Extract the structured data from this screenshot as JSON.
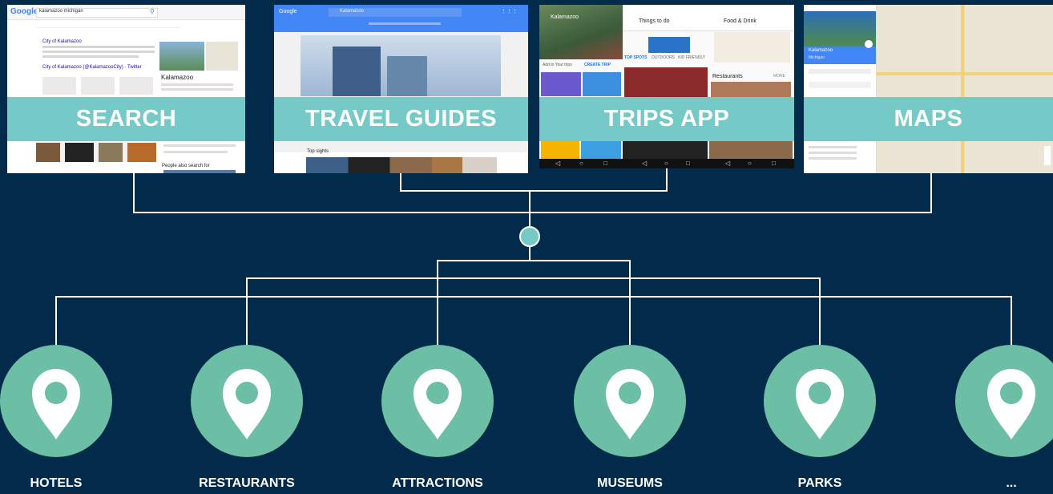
{
  "sources": [
    {
      "label": "SEARCH"
    },
    {
      "label": "TRAVEL GUIDES"
    },
    {
      "label": "TRIPS APP"
    },
    {
      "label": "MAPS"
    }
  ],
  "screens": {
    "search": {
      "logo": "Google",
      "query": "kalamazoo michigan",
      "result1_title": "City of Kalamazoo",
      "result2_title": "City of Kalamazoo (@KalamazooCity) · Twitter",
      "kp_title": "Kalamazoo",
      "kp_people_also": "People also search for"
    },
    "guides": {
      "logo": "Google",
      "query": "Kalamazoo",
      "top_sights": "Top sights"
    },
    "trips": {
      "city": "Kalamazoo",
      "things_to_do": "Things to do",
      "food_drink": "Food & Drink",
      "add_trips": "Add to Your trips",
      "create_trip": "CREATE TRIP",
      "top_spots": "TOP SPOTS",
      "outdoors": "OUTDOORS",
      "kid_friendly": "KID FRIENDLY",
      "restaurants": "Restaurants",
      "more": "MORE"
    },
    "maps": {
      "place": "Kalamazoo",
      "region": "Michigan"
    }
  },
  "categories": [
    {
      "label": "HOTELS"
    },
    {
      "label": "RESTAURANTS"
    },
    {
      "label": "ATTRACTIONS"
    },
    {
      "label": "MUSEUMS"
    },
    {
      "label": "PARKS"
    },
    {
      "label": "..."
    }
  ],
  "colors": {
    "background": "#022a4a",
    "accent": "#75c9c6",
    "pin_circle": "#6cbfa5",
    "connector": "#ffffff"
  }
}
